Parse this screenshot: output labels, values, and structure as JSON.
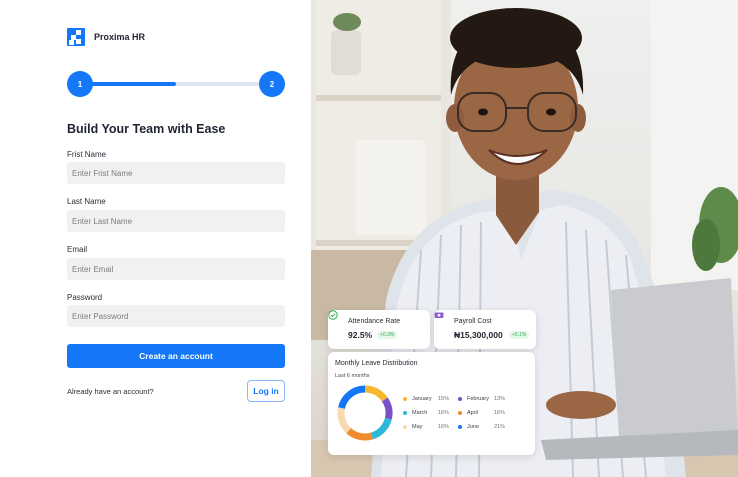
{
  "brand": {
    "name": "Proxima HR"
  },
  "stepper": {
    "steps": [
      "1",
      "2"
    ],
    "progress": 0.5
  },
  "form": {
    "title": "Build Your Team with Ease",
    "first_name": {
      "label": "Frist Name",
      "placeholder": "Enter Frist Name"
    },
    "last_name": {
      "label": "Last Name",
      "placeholder": "Enter Last Name"
    },
    "email": {
      "label": "Email",
      "placeholder": "Enter Email"
    },
    "password": {
      "label": "Password",
      "placeholder": "Enter Password"
    },
    "create_label": "Create an account",
    "have_account": "Already have an account?",
    "login_label": "Log in"
  },
  "stats": {
    "attendance": {
      "title": "Attendance Rate",
      "value": "92.5%",
      "change": "+0.3%",
      "icon": "check-circle-icon"
    },
    "payroll": {
      "title": "Payroll Cost",
      "value": "₦15,300,000",
      "change": "+5.1%",
      "icon": "money-icon"
    }
  },
  "leave": {
    "title": "Monthly Leave Distribution",
    "subtitle": "Last 6 months",
    "months": [
      {
        "name": "January",
        "pct": "15%",
        "color": "#f5b82e"
      },
      {
        "name": "February",
        "pct": "13%",
        "color": "#7b4fc9"
      },
      {
        "name": "March",
        "pct": "16%",
        "color": "#2fb8d9"
      },
      {
        "name": "April",
        "pct": "16%",
        "color": "#f08a2b"
      },
      {
        "name": "May",
        "pct": "16%",
        "color": "#f8d9b0"
      },
      {
        "name": "June",
        "pct": "21%",
        "color": "#1477f8"
      }
    ]
  },
  "colors": {
    "accent": "#1477f8",
    "positive": "#2fae55"
  }
}
